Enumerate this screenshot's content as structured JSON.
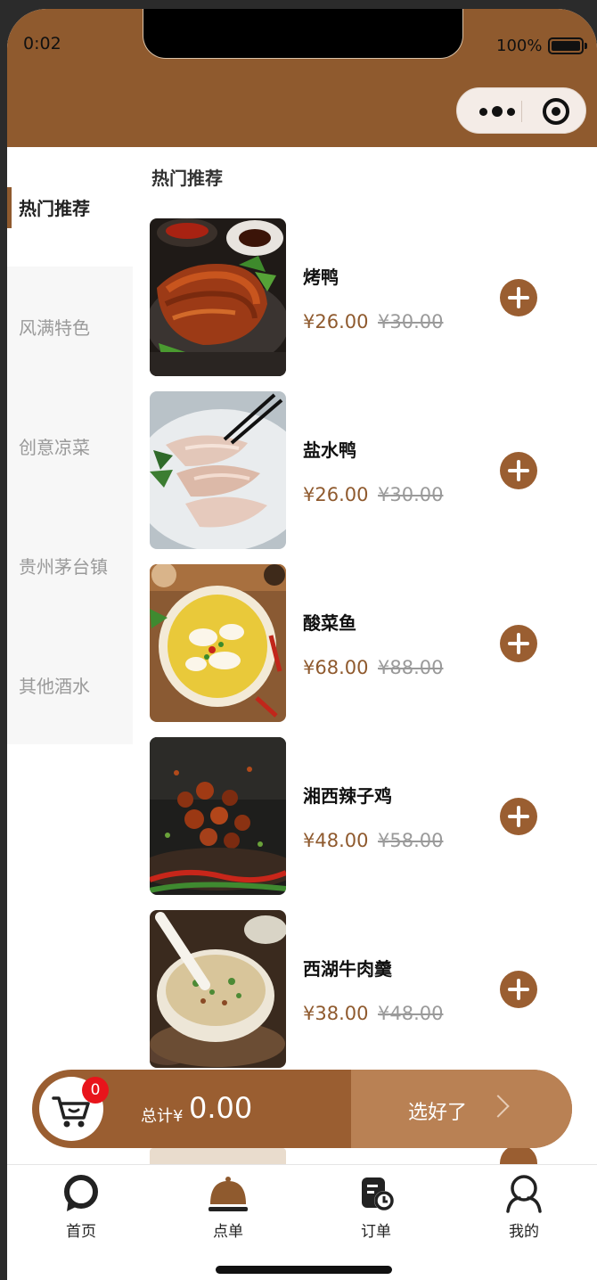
{
  "status": {
    "time": "0:02",
    "battery": "100%"
  },
  "sidebar": {
    "items": [
      {
        "label": "热门推荐",
        "active": true
      },
      {
        "label": "风满特色",
        "active": false
      },
      {
        "label": "创意凉菜",
        "active": false
      },
      {
        "label": "贵州茅台镇",
        "active": false
      },
      {
        "label": "其他酒水",
        "active": false
      }
    ]
  },
  "main": {
    "section_title": "热门推荐",
    "dishes": [
      {
        "name": "烤鸭",
        "price": "¥26.00",
        "original_price": "¥30.00"
      },
      {
        "name": "盐水鸭",
        "price": "¥26.00",
        "original_price": "¥30.00"
      },
      {
        "name": "酸菜鱼",
        "price": "¥68.00",
        "original_price": "¥88.00"
      },
      {
        "name": "湘西辣子鸡",
        "price": "¥48.00",
        "original_price": "¥58.00"
      },
      {
        "name": "西湖牛肉羹",
        "price": "¥38.00",
        "original_price": "¥48.00"
      }
    ]
  },
  "cart": {
    "count": "0",
    "total_label": "总计¥",
    "total_value": "0.00",
    "submit_label": "选好了"
  },
  "tabbar": {
    "items": [
      {
        "label": "首页",
        "icon": "home-icon"
      },
      {
        "label": "点单",
        "icon": "order-cloche-icon",
        "active": true
      },
      {
        "label": "订单",
        "icon": "orders-icon"
      },
      {
        "label": "我的",
        "icon": "profile-icon"
      }
    ]
  },
  "colors": {
    "brand": "#8f5a2e",
    "accent": "#9a5e31",
    "accent_light": "#b98154",
    "badge": "#e8141b"
  }
}
